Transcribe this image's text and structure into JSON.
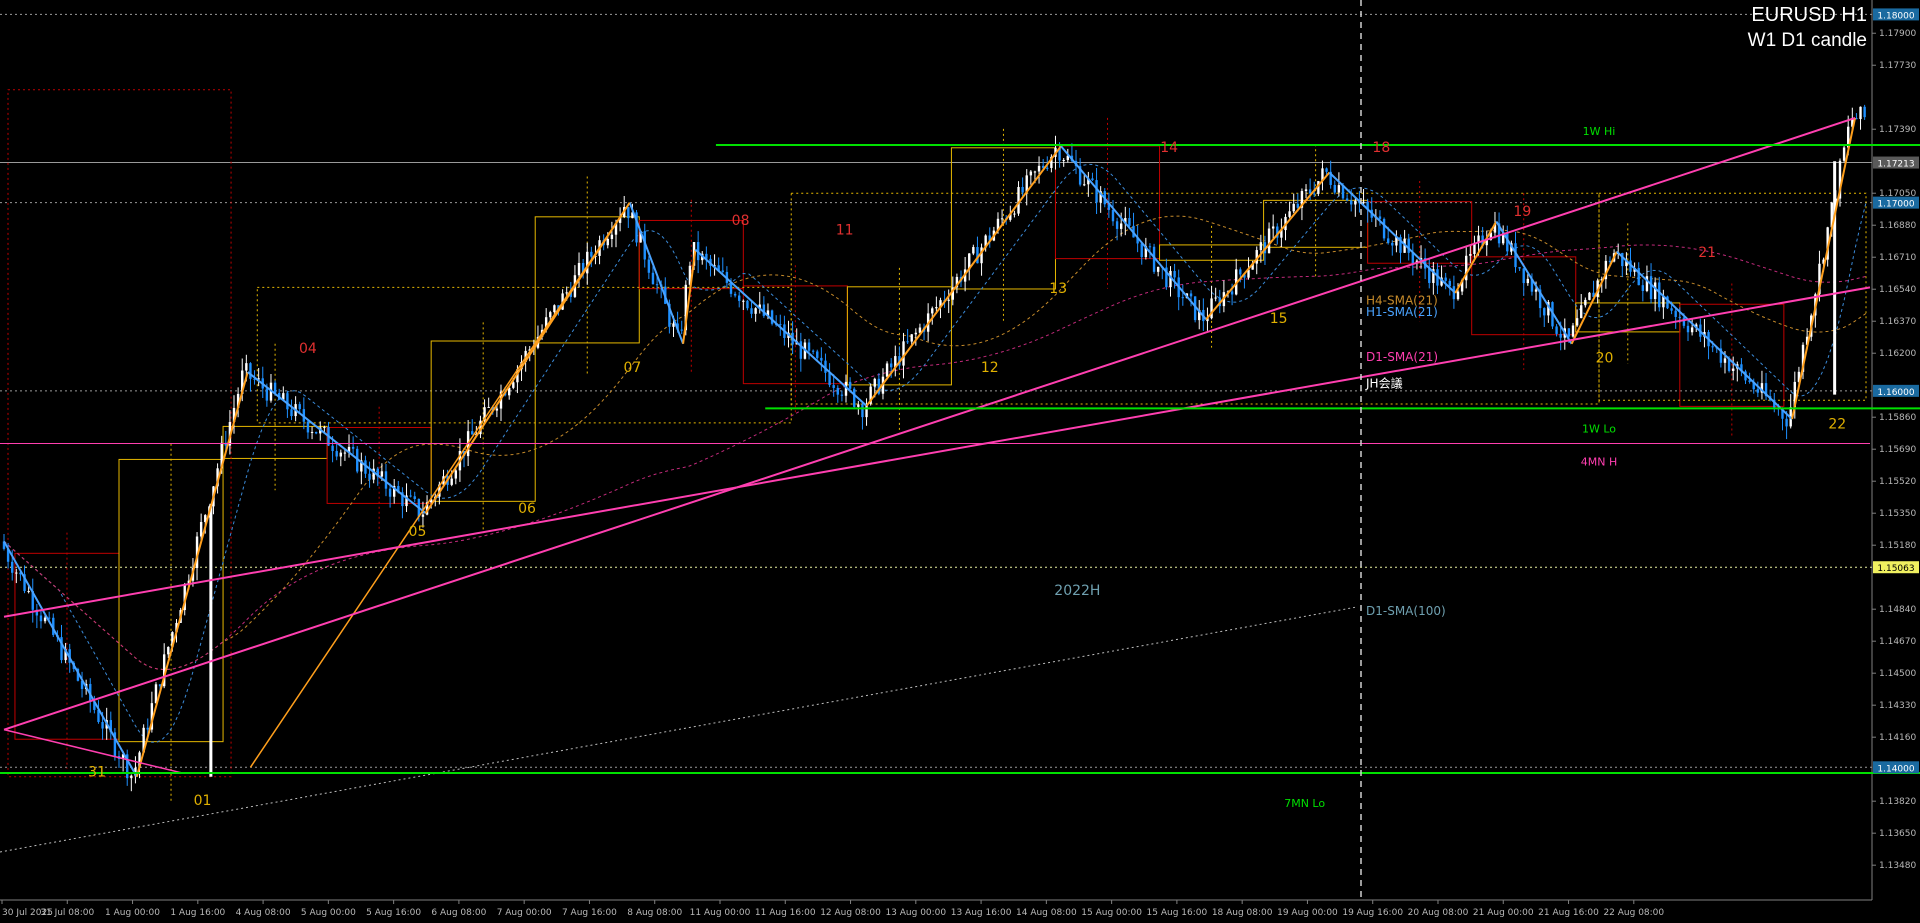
{
  "header": {
    "symbol": "EURUSD H1",
    "subtitle": "W1 D1 candle"
  },
  "colors": {
    "background": "#000000",
    "bull_candle": "#ffffff",
    "bear_candle": "#1e90ff",
    "zigzag_up": "#ff9f1c",
    "zigzag_down": "#4aa3ff",
    "level_green": "#00e000",
    "trendline": "#ff3fb0",
    "daily_box_bull": "#e6b800",
    "daily_box_bear": "#c00000",
    "price_box": "#1a6aa0",
    "axis_text": "#b8b8b8"
  },
  "chart_data": {
    "type": "candlestick",
    "title": "EURUSD H1",
    "subtitle": "W1 D1 candle",
    "ylim": [
      1.13295,
      1.1805
    ],
    "x_ticks": [
      "30 Jul 2025",
      "31 Jul 08:00",
      "1 Aug 00:00",
      "1 Aug 16:00",
      "4 Aug 08:00",
      "5 Aug 00:00",
      "5 Aug 16:00",
      "6 Aug 08:00",
      "7 Aug 00:00",
      "7 Aug 16:00",
      "8 Aug 08:00",
      "11 Aug 00:00",
      "11 Aug 16:00",
      "12 Aug 08:00",
      "13 Aug 00:00",
      "13 Aug 16:00",
      "14 Aug 08:00",
      "15 Aug 00:00",
      "15 Aug 16:00",
      "18 Aug 08:00",
      "19 Aug 00:00",
      "19 Aug 16:00",
      "20 Aug 08:00",
      "21 Aug 00:00",
      "21 Aug 16:00",
      "22 Aug 08:00"
    ],
    "y_ticks": [
      "1.17900",
      "1.17730",
      "1.17390",
      "1.17050",
      "1.16880",
      "1.16710",
      "1.16540",
      "1.16370",
      "1.16200",
      "1.15860",
      "1.15690",
      "1.15520",
      "1.15350",
      "1.15180",
      "1.14840",
      "1.14670",
      "1.14500",
      "1.14330",
      "1.14160",
      "1.13820",
      "1.13650",
      "1.13480"
    ],
    "price_boxes": [
      {
        "value": 1.18,
        "label": "1.18000"
      },
      {
        "value": 1.17213,
        "label": "1.17213"
      },
      {
        "value": 1.17,
        "label": "1.17000"
      },
      {
        "value": 1.16,
        "label": "1.16000"
      },
      {
        "value": 1.15063,
        "label": "1.15063"
      },
      {
        "value": 1.14,
        "label": "1.14000"
      }
    ],
    "levels": [
      {
        "name": "1W Hi",
        "value": 1.17306
      },
      {
        "name": "1W Lo",
        "value": 1.15907
      },
      {
        "name": "4MN H",
        "value": 1.1572
      },
      {
        "name": "2022H",
        "value": 1.15063
      },
      {
        "name": "7MN Lo",
        "value": 1.1397
      }
    ],
    "indicators": [
      "H4-SMA(21)",
      "H1-SMA(21)",
      "D1-SMA(21)",
      "JH会議",
      "D1-SMA(100)"
    ],
    "zigzag": [
      {
        "i": 0,
        "v": 1.152
      },
      {
        "i": 97,
        "v": 1.1395
      },
      {
        "i": 178,
        "v": 1.161
      },
      {
        "i": 308,
        "v": 1.1535
      },
      {
        "i": 457,
        "v": 1.17
      },
      {
        "i": 496,
        "v": 1.1625
      },
      {
        "i": 505,
        "v": 1.1675
      },
      {
        "i": 630,
        "v": 1.1592
      },
      {
        "i": 772,
        "v": 1.173
      },
      {
        "i": 878,
        "v": 1.1638
      },
      {
        "i": 968,
        "v": 1.1716
      },
      {
        "i": 1060,
        "v": 1.1652
      },
      {
        "i": 1090,
        "v": 1.169
      },
      {
        "i": 1145,
        "v": 1.1625
      },
      {
        "i": 1178,
        "v": 1.1674
      },
      {
        "i": 1306,
        "v": 1.1585
      },
      {
        "i": 1352,
        "v": 1.1745
      }
    ],
    "day_labels": [
      {
        "label": "31",
        "i": 68,
        "pos": "below",
        "v": 1.1395
      },
      {
        "label": "01",
        "i": 145,
        "pos": "below",
        "v": 1.138
      },
      {
        "label": "04",
        "i": 222,
        "pos": "above",
        "v": 1.162
      },
      {
        "label": "05",
        "i": 302,
        "pos": "below",
        "v": 1.1523
      },
      {
        "label": "06",
        "i": 382,
        "pos": "below",
        "v": 1.1535
      },
      {
        "label": "07",
        "i": 459,
        "pos": "below",
        "v": 1.161
      },
      {
        "label": "08",
        "i": 538,
        "pos": "above",
        "v": 1.1688
      },
      {
        "label": "11",
        "i": 614,
        "pos": "above",
        "v": 1.1683
      },
      {
        "label": "12",
        "i": 720,
        "pos": "below",
        "v": 1.161
      },
      {
        "label": "13",
        "i": 770,
        "pos": "below",
        "v": 1.1652
      },
      {
        "label": "14",
        "i": 851,
        "pos": "above",
        "v": 1.1727
      },
      {
        "label": "15",
        "i": 931,
        "pos": "below",
        "v": 1.1636
      },
      {
        "label": "18",
        "i": 1006,
        "pos": "above",
        "v": 1.1727
      },
      {
        "label": "19",
        "i": 1109,
        "pos": "above",
        "v": 1.1693
      },
      {
        "label": "20",
        "i": 1169,
        "pos": "below",
        "v": 1.1615
      },
      {
        "label": "21",
        "i": 1244,
        "pos": "above",
        "v": 1.1671
      },
      {
        "label": "22",
        "i": 1339,
        "pos": "below",
        "v": 1.158
      }
    ]
  }
}
